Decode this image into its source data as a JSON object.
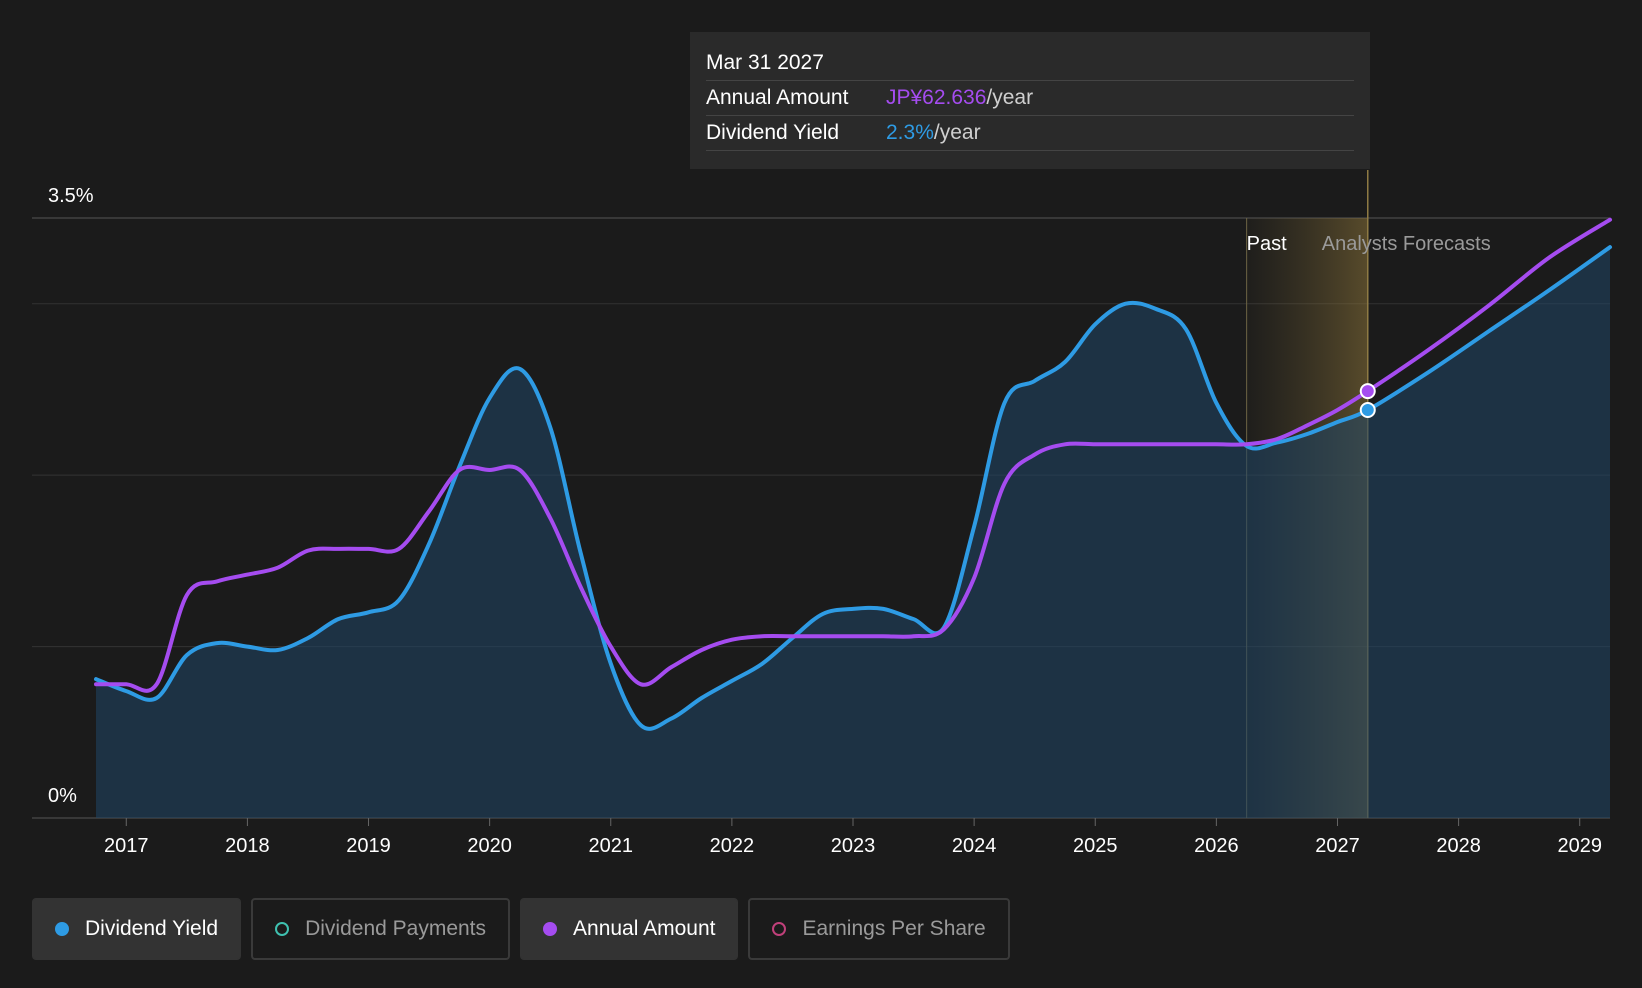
{
  "tooltip": {
    "date": "Mar 31 2027",
    "rows": [
      {
        "label": "Annual Amount",
        "value": "JP¥62.636",
        "unit": "/year",
        "color": "#a54cf0"
      },
      {
        "label": "Dividend Yield",
        "value": "2.3%",
        "unit": "/year",
        "color": "#2e9be4"
      }
    ]
  },
  "legend": [
    {
      "label": "Dividend Yield",
      "color": "#2e9be4",
      "active": true
    },
    {
      "label": "Dividend Payments",
      "color": "#3fc1b0",
      "active": false
    },
    {
      "label": "Annual Amount",
      "color": "#a54cf0",
      "active": true
    },
    {
      "label": "Earnings Per Share",
      "color": "#c0407a",
      "active": false
    }
  ],
  "chart_data": {
    "type": "line",
    "y_labels": {
      "top": "3.5%",
      "bottom": "0%"
    },
    "ylim": [
      0,
      3.5
    ],
    "xlim": [
      2016.75,
      2029.25
    ],
    "x_ticks": [
      "2017",
      "2018",
      "2019",
      "2020",
      "2021",
      "2022",
      "2023",
      "2024",
      "2025",
      "2026",
      "2027",
      "2028",
      "2029"
    ],
    "regions": {
      "past_label": "Past",
      "forecast_label": "Analysts Forecasts",
      "past_end": 2026.25,
      "forecast_highlight_end": 2027.25
    },
    "highlight_x": 2027.25,
    "grid": true,
    "series": [
      {
        "name": "Dividend Yield",
        "color": "#2e9be4",
        "area": true,
        "points": [
          [
            2016.75,
            0.81
          ],
          [
            2017.0,
            0.74
          ],
          [
            2017.25,
            0.7
          ],
          [
            2017.5,
            0.95
          ],
          [
            2017.75,
            1.02
          ],
          [
            2018.0,
            1.0
          ],
          [
            2018.25,
            0.98
          ],
          [
            2018.5,
            1.05
          ],
          [
            2018.75,
            1.16
          ],
          [
            2019.0,
            1.2
          ],
          [
            2019.25,
            1.27
          ],
          [
            2019.5,
            1.6
          ],
          [
            2019.75,
            2.05
          ],
          [
            2020.0,
            2.45
          ],
          [
            2020.25,
            2.62
          ],
          [
            2020.5,
            2.28
          ],
          [
            2020.75,
            1.55
          ],
          [
            2021.0,
            0.9
          ],
          [
            2021.25,
            0.54
          ],
          [
            2021.5,
            0.58
          ],
          [
            2021.75,
            0.7
          ],
          [
            2022.0,
            0.8
          ],
          [
            2022.25,
            0.9
          ],
          [
            2022.5,
            1.05
          ],
          [
            2022.75,
            1.19
          ],
          [
            2023.0,
            1.22
          ],
          [
            2023.25,
            1.22
          ],
          [
            2023.5,
            1.16
          ],
          [
            2023.75,
            1.11
          ],
          [
            2024.0,
            1.7
          ],
          [
            2024.25,
            2.42
          ],
          [
            2024.5,
            2.55
          ],
          [
            2024.75,
            2.66
          ],
          [
            2025.0,
            2.88
          ],
          [
            2025.25,
            3.0
          ],
          [
            2025.5,
            2.97
          ],
          [
            2025.75,
            2.85
          ],
          [
            2026.0,
            2.42
          ],
          [
            2026.25,
            2.17
          ],
          [
            2026.5,
            2.19
          ],
          [
            2026.75,
            2.24
          ],
          [
            2027.0,
            2.31
          ],
          [
            2027.25,
            2.38
          ],
          [
            2027.75,
            2.6
          ],
          [
            2028.25,
            2.84
          ],
          [
            2028.75,
            3.08
          ],
          [
            2029.25,
            3.33
          ]
        ]
      },
      {
        "name": "Annual Amount",
        "color": "#a54cf0",
        "area": false,
        "points": [
          [
            2016.75,
            0.78
          ],
          [
            2017.0,
            0.78
          ],
          [
            2017.25,
            0.78
          ],
          [
            2017.5,
            1.3
          ],
          [
            2017.75,
            1.38
          ],
          [
            2018.0,
            1.42
          ],
          [
            2018.25,
            1.46
          ],
          [
            2018.5,
            1.56
          ],
          [
            2018.75,
            1.57
          ],
          [
            2019.0,
            1.57
          ],
          [
            2019.25,
            1.57
          ],
          [
            2019.5,
            1.79
          ],
          [
            2019.75,
            2.03
          ],
          [
            2020.0,
            2.03
          ],
          [
            2020.25,
            2.03
          ],
          [
            2020.5,
            1.75
          ],
          [
            2020.75,
            1.35
          ],
          [
            2021.0,
            1.0
          ],
          [
            2021.25,
            0.78
          ],
          [
            2021.5,
            0.88
          ],
          [
            2021.75,
            0.98
          ],
          [
            2022.0,
            1.04
          ],
          [
            2022.25,
            1.06
          ],
          [
            2022.5,
            1.06
          ],
          [
            2022.75,
            1.06
          ],
          [
            2023.0,
            1.06
          ],
          [
            2023.25,
            1.06
          ],
          [
            2023.5,
            1.06
          ],
          [
            2023.75,
            1.1
          ],
          [
            2024.0,
            1.4
          ],
          [
            2024.25,
            1.95
          ],
          [
            2024.5,
            2.12
          ],
          [
            2024.75,
            2.18
          ],
          [
            2025.0,
            2.18
          ],
          [
            2025.25,
            2.18
          ],
          [
            2025.5,
            2.18
          ],
          [
            2025.75,
            2.18
          ],
          [
            2026.0,
            2.18
          ],
          [
            2026.25,
            2.18
          ],
          [
            2026.5,
            2.21
          ],
          [
            2026.75,
            2.29
          ],
          [
            2027.0,
            2.38
          ],
          [
            2027.25,
            2.49
          ],
          [
            2027.75,
            2.73
          ],
          [
            2028.25,
            2.99
          ],
          [
            2028.75,
            3.27
          ],
          [
            2029.25,
            3.49
          ]
        ]
      }
    ]
  }
}
